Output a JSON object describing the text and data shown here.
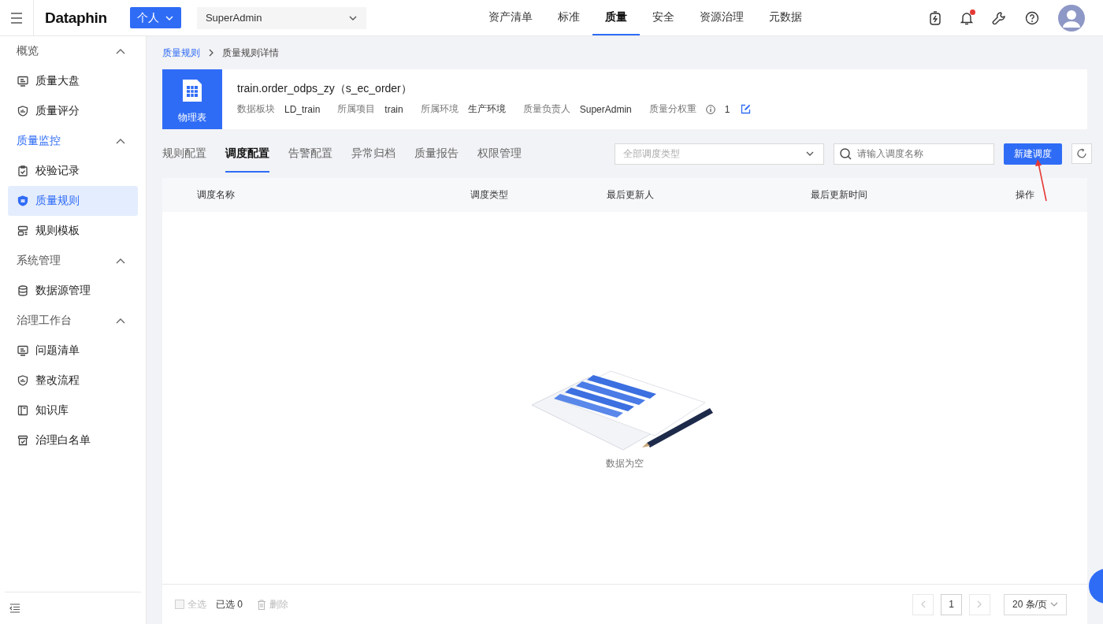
{
  "header": {
    "logo": "Dataphin",
    "space_button": "个人",
    "project_select": "SuperAdmin",
    "notification_dot": true,
    "nav": [
      {
        "label": "资产清单",
        "selected": false
      },
      {
        "label": "标准",
        "selected": false
      },
      {
        "label": "质量",
        "selected": true
      },
      {
        "label": "安全",
        "selected": false
      },
      {
        "label": "资源治理",
        "selected": false
      },
      {
        "label": "元数据",
        "selected": false
      }
    ]
  },
  "sidebar": {
    "groups": [
      {
        "label": "概览",
        "active": false,
        "expanded": true,
        "items": [
          {
            "label": "质量大盘",
            "selected": false
          },
          {
            "label": "质量评分",
            "selected": false
          }
        ]
      },
      {
        "label": "质量监控",
        "active": true,
        "expanded": true,
        "items": [
          {
            "label": "校验记录",
            "selected": false
          },
          {
            "label": "质量规则",
            "selected": true
          },
          {
            "label": "规则模板",
            "selected": false
          }
        ]
      },
      {
        "label": "系统管理",
        "active": false,
        "expanded": true,
        "items": [
          {
            "label": "数据源管理",
            "selected": false
          }
        ]
      },
      {
        "label": "治理工作台",
        "active": false,
        "expanded": true,
        "items": [
          {
            "label": "问题清单",
            "selected": false
          },
          {
            "label": "整改流程",
            "selected": false
          },
          {
            "label": "知识库",
            "selected": false
          },
          {
            "label": "治理白名单",
            "selected": false
          }
        ]
      }
    ]
  },
  "breadcrumb": [
    "质量规则",
    "质量规则详情"
  ],
  "table_info": {
    "type_label": "物理表",
    "name": "train.order_odps_zy（s_ec_order）",
    "meta": [
      {
        "label": "数据板块",
        "value": "LD_train"
      },
      {
        "label": "所属项目",
        "value": "train"
      },
      {
        "label": "所属环境",
        "value": "生产环境"
      },
      {
        "label": "质量负责人",
        "value": "SuperAdmin"
      }
    ],
    "weight": {
      "label": "质量分权重",
      "value": "1"
    }
  },
  "tabs": [
    {
      "label": "规则配置",
      "selected": false
    },
    {
      "label": "调度配置",
      "selected": true
    },
    {
      "label": "告警配置",
      "selected": false
    },
    {
      "label": "异常归档",
      "selected": false
    },
    {
      "label": "质量报告",
      "selected": false
    },
    {
      "label": "权限管理",
      "selected": false
    }
  ],
  "toolbar": {
    "type_filter": {
      "placeholder": "全部调度类型"
    },
    "search": {
      "placeholder": "请输入调度名称"
    },
    "create_button": "新建调度"
  },
  "table": {
    "columns": [
      "调度名称",
      "调度类型",
      "最后更新人",
      "最后更新时间",
      "操作"
    ],
    "empty_text": "数据为空"
  },
  "footer": {
    "select_all": {
      "label": "全选",
      "checked": false,
      "disabled": true
    },
    "selected_count": "已选 0",
    "delete": {
      "label": "删除",
      "disabled": true
    },
    "page": "1",
    "page_size": "20 条/页"
  }
}
